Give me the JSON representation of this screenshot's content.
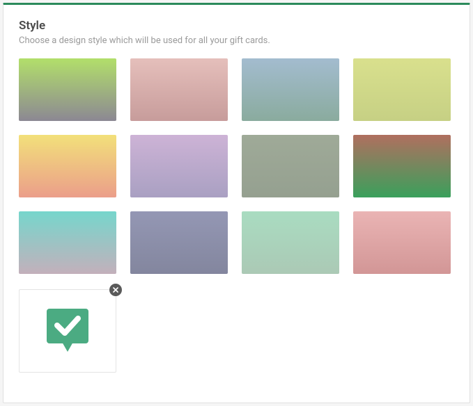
{
  "header": {
    "title": "Style",
    "subtitle": "Choose a design style which will be used for all your gift cards."
  },
  "accent_color": "#2b8a5b",
  "swatches": [
    {
      "id": "style-1",
      "from": "#b2df6a",
      "to": "#8c8893"
    },
    {
      "id": "style-2",
      "from": "#e5bfbb",
      "to": "#c79c9b"
    },
    {
      "id": "style-3",
      "from": "#a3bccf",
      "to": "#8aab9e"
    },
    {
      "id": "style-4",
      "from": "#d9e08d",
      "to": "#c6d084"
    },
    {
      "id": "style-5",
      "from": "#f2e07a",
      "to": "#eb9e8a"
    },
    {
      "id": "style-6",
      "from": "#cdb3d6",
      "to": "#a9a0c2"
    },
    {
      "id": "style-7",
      "from": "#9faa98",
      "to": "#95a090"
    },
    {
      "id": "style-8",
      "from": "#b06f5f",
      "to": "#3aa05c"
    },
    {
      "id": "style-9",
      "from": "#76d6cc",
      "to": "#c3b0bb"
    },
    {
      "id": "style-10",
      "from": "#9497b4",
      "to": "#83869e"
    },
    {
      "id": "style-11",
      "from": "#a9dcc1",
      "to": "#abc9b5"
    },
    {
      "id": "style-12",
      "from": "#eab4b4",
      "to": "#d29696"
    }
  ],
  "custom_tile": {
    "icon": "check-badge-icon",
    "icon_color": "#4bab82",
    "check_color": "#ffffff",
    "close_label": "Remove custom design"
  }
}
